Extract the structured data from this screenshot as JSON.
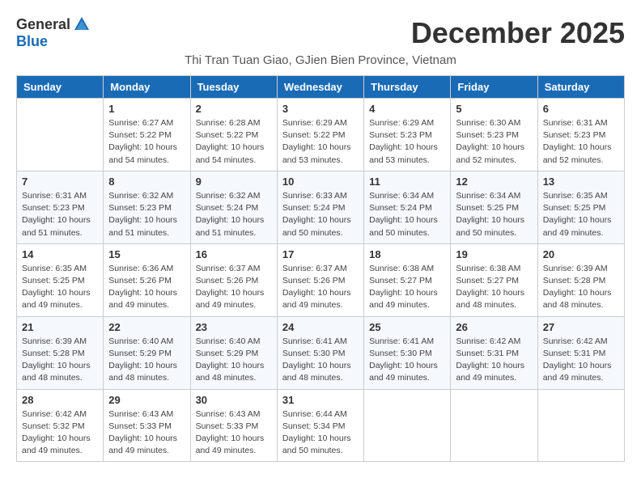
{
  "header": {
    "logo_general": "General",
    "logo_blue": "Blue",
    "month_title": "December 2025",
    "subtitle": "Thi Tran Tuan Giao, GJien Bien Province, Vietnam"
  },
  "weekdays": [
    "Sunday",
    "Monday",
    "Tuesday",
    "Wednesday",
    "Thursday",
    "Friday",
    "Saturday"
  ],
  "weeks": [
    [
      {
        "day": "",
        "info": ""
      },
      {
        "day": "1",
        "info": "Sunrise: 6:27 AM\nSunset: 5:22 PM\nDaylight: 10 hours\nand 54 minutes."
      },
      {
        "day": "2",
        "info": "Sunrise: 6:28 AM\nSunset: 5:22 PM\nDaylight: 10 hours\nand 54 minutes."
      },
      {
        "day": "3",
        "info": "Sunrise: 6:29 AM\nSunset: 5:22 PM\nDaylight: 10 hours\nand 53 minutes."
      },
      {
        "day": "4",
        "info": "Sunrise: 6:29 AM\nSunset: 5:23 PM\nDaylight: 10 hours\nand 53 minutes."
      },
      {
        "day": "5",
        "info": "Sunrise: 6:30 AM\nSunset: 5:23 PM\nDaylight: 10 hours\nand 52 minutes."
      },
      {
        "day": "6",
        "info": "Sunrise: 6:31 AM\nSunset: 5:23 PM\nDaylight: 10 hours\nand 52 minutes."
      }
    ],
    [
      {
        "day": "7",
        "info": "Sunrise: 6:31 AM\nSunset: 5:23 PM\nDaylight: 10 hours\nand 51 minutes."
      },
      {
        "day": "8",
        "info": "Sunrise: 6:32 AM\nSunset: 5:23 PM\nDaylight: 10 hours\nand 51 minutes."
      },
      {
        "day": "9",
        "info": "Sunrise: 6:32 AM\nSunset: 5:24 PM\nDaylight: 10 hours\nand 51 minutes."
      },
      {
        "day": "10",
        "info": "Sunrise: 6:33 AM\nSunset: 5:24 PM\nDaylight: 10 hours\nand 50 minutes."
      },
      {
        "day": "11",
        "info": "Sunrise: 6:34 AM\nSunset: 5:24 PM\nDaylight: 10 hours\nand 50 minutes."
      },
      {
        "day": "12",
        "info": "Sunrise: 6:34 AM\nSunset: 5:25 PM\nDaylight: 10 hours\nand 50 minutes."
      },
      {
        "day": "13",
        "info": "Sunrise: 6:35 AM\nSunset: 5:25 PM\nDaylight: 10 hours\nand 49 minutes."
      }
    ],
    [
      {
        "day": "14",
        "info": "Sunrise: 6:35 AM\nSunset: 5:25 PM\nDaylight: 10 hours\nand 49 minutes."
      },
      {
        "day": "15",
        "info": "Sunrise: 6:36 AM\nSunset: 5:26 PM\nDaylight: 10 hours\nand 49 minutes."
      },
      {
        "day": "16",
        "info": "Sunrise: 6:37 AM\nSunset: 5:26 PM\nDaylight: 10 hours\nand 49 minutes."
      },
      {
        "day": "17",
        "info": "Sunrise: 6:37 AM\nSunset: 5:26 PM\nDaylight: 10 hours\nand 49 minutes."
      },
      {
        "day": "18",
        "info": "Sunrise: 6:38 AM\nSunset: 5:27 PM\nDaylight: 10 hours\nand 49 minutes."
      },
      {
        "day": "19",
        "info": "Sunrise: 6:38 AM\nSunset: 5:27 PM\nDaylight: 10 hours\nand 48 minutes."
      },
      {
        "day": "20",
        "info": "Sunrise: 6:39 AM\nSunset: 5:28 PM\nDaylight: 10 hours\nand 48 minutes."
      }
    ],
    [
      {
        "day": "21",
        "info": "Sunrise: 6:39 AM\nSunset: 5:28 PM\nDaylight: 10 hours\nand 48 minutes."
      },
      {
        "day": "22",
        "info": "Sunrise: 6:40 AM\nSunset: 5:29 PM\nDaylight: 10 hours\nand 48 minutes."
      },
      {
        "day": "23",
        "info": "Sunrise: 6:40 AM\nSunset: 5:29 PM\nDaylight: 10 hours\nand 48 minutes."
      },
      {
        "day": "24",
        "info": "Sunrise: 6:41 AM\nSunset: 5:30 PM\nDaylight: 10 hours\nand 48 minutes."
      },
      {
        "day": "25",
        "info": "Sunrise: 6:41 AM\nSunset: 5:30 PM\nDaylight: 10 hours\nand 49 minutes."
      },
      {
        "day": "26",
        "info": "Sunrise: 6:42 AM\nSunset: 5:31 PM\nDaylight: 10 hours\nand 49 minutes."
      },
      {
        "day": "27",
        "info": "Sunrise: 6:42 AM\nSunset: 5:31 PM\nDaylight: 10 hours\nand 49 minutes."
      }
    ],
    [
      {
        "day": "28",
        "info": "Sunrise: 6:42 AM\nSunset: 5:32 PM\nDaylight: 10 hours\nand 49 minutes."
      },
      {
        "day": "29",
        "info": "Sunrise: 6:43 AM\nSunset: 5:33 PM\nDaylight: 10 hours\nand 49 minutes."
      },
      {
        "day": "30",
        "info": "Sunrise: 6:43 AM\nSunset: 5:33 PM\nDaylight: 10 hours\nand 49 minutes."
      },
      {
        "day": "31",
        "info": "Sunrise: 6:44 AM\nSunset: 5:34 PM\nDaylight: 10 hours\nand 50 minutes."
      },
      {
        "day": "",
        "info": ""
      },
      {
        "day": "",
        "info": ""
      },
      {
        "day": "",
        "info": ""
      }
    ]
  ]
}
